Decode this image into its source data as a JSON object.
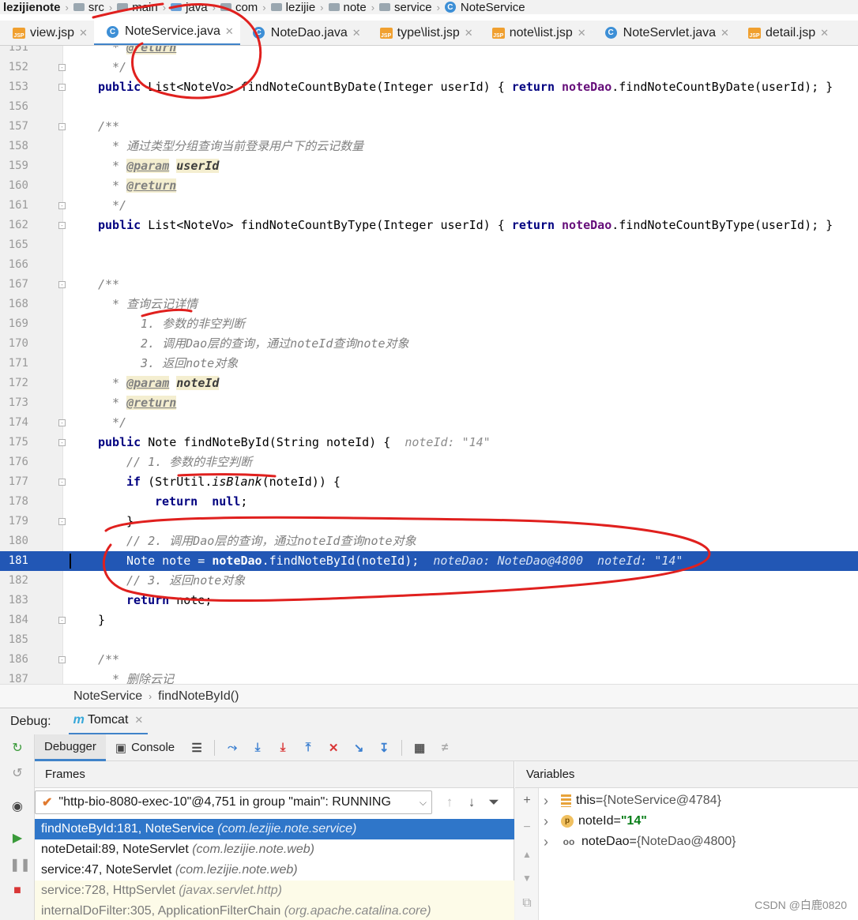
{
  "breadcrumb": [
    "lezijienote",
    "src",
    "main",
    "java",
    "com",
    "lezijie",
    "note",
    "service",
    "NoteService"
  ],
  "tabs": [
    {
      "label": "view.jsp",
      "icon": "jsp-file-icon",
      "active": false
    },
    {
      "label": "NoteService.java",
      "icon": "java-class-icon",
      "active": true
    },
    {
      "label": "NoteDao.java",
      "icon": "java-class-icon",
      "active": false
    },
    {
      "label": "type\\list.jsp",
      "icon": "jsp-file-icon",
      "active": false
    },
    {
      "label": "note\\list.jsp",
      "icon": "jsp-file-icon",
      "active": false
    },
    {
      "label": "NoteServlet.java",
      "icon": "java-class-icon",
      "active": false
    },
    {
      "label": "detail.jsp",
      "icon": "jsp-file-icon",
      "active": false
    }
  ],
  "editor": {
    "current_line": "181",
    "lines": [
      {
        "n": "151",
        "indent": 1,
        "fold": false,
        "parts": [
          {
            "t": "* ",
            "c": "cm"
          },
          {
            "t": "@return",
            "c": "tag"
          }
        ]
      },
      {
        "n": "152",
        "indent": 1,
        "fold": true,
        "parts": [
          {
            "t": "*/",
            "c": "cm"
          }
        ]
      },
      {
        "n": "153",
        "indent": 0,
        "fold": true,
        "parts": [
          {
            "t": "public ",
            "c": "kw"
          },
          {
            "t": "List<NoteVo> findNoteCountByDate(Integer userId) { ",
            "c": ""
          },
          {
            "t": "return ",
            "c": "kw"
          },
          {
            "t": "noteDao",
            "c": "fld"
          },
          {
            "t": ".findNoteCountByDate(userId); }",
            "c": ""
          }
        ]
      },
      {
        "n": "156",
        "indent": 0,
        "fold": false,
        "parts": []
      },
      {
        "n": "157",
        "indent": 0,
        "fold": true,
        "parts": [
          {
            "t": "/**",
            "c": "cm"
          }
        ]
      },
      {
        "n": "158",
        "indent": 1,
        "fold": false,
        "parts": [
          {
            "t": "* 通过类型分组查询当前登录用户下的云记数量",
            "c": "cm"
          }
        ]
      },
      {
        "n": "159",
        "indent": 1,
        "fold": false,
        "parts": [
          {
            "t": "* ",
            "c": "cm"
          },
          {
            "t": "@param",
            "c": "tag"
          },
          {
            "t": " ",
            "c": "cm"
          },
          {
            "t": "userId",
            "c": "pv"
          }
        ]
      },
      {
        "n": "160",
        "indent": 1,
        "fold": false,
        "parts": [
          {
            "t": "* ",
            "c": "cm"
          },
          {
            "t": "@return",
            "c": "tag"
          }
        ]
      },
      {
        "n": "161",
        "indent": 1,
        "fold": true,
        "parts": [
          {
            "t": "*/",
            "c": "cm"
          }
        ]
      },
      {
        "n": "162",
        "indent": 0,
        "fold": true,
        "parts": [
          {
            "t": "public ",
            "c": "kw"
          },
          {
            "t": "List<NoteVo> findNoteCountByType(Integer userId) { ",
            "c": ""
          },
          {
            "t": "return ",
            "c": "kw"
          },
          {
            "t": "noteDao",
            "c": "fld"
          },
          {
            "t": ".findNoteCountByType(userId); }",
            "c": ""
          }
        ]
      },
      {
        "n": "165",
        "indent": 0,
        "fold": false,
        "parts": []
      },
      {
        "n": "166",
        "indent": 0,
        "fold": false,
        "parts": []
      },
      {
        "n": "167",
        "indent": 0,
        "fold": true,
        "parts": [
          {
            "t": "/**",
            "c": "cm"
          }
        ]
      },
      {
        "n": "168",
        "indent": 1,
        "fold": false,
        "parts": [
          {
            "t": "* 查询云记详情",
            "c": "cm"
          }
        ]
      },
      {
        "n": "169",
        "indent": 3,
        "fold": false,
        "parts": [
          {
            "t": "1. 参数的非空判断",
            "c": "cm"
          }
        ]
      },
      {
        "n": "170",
        "indent": 3,
        "fold": false,
        "parts": [
          {
            "t": "2. 调用Dao层的查询，通过noteId查询note对象",
            "c": "cm"
          }
        ]
      },
      {
        "n": "171",
        "indent": 3,
        "fold": false,
        "parts": [
          {
            "t": "3. 返回note对象",
            "c": "cm"
          }
        ]
      },
      {
        "n": "172",
        "indent": 1,
        "fold": false,
        "parts": [
          {
            "t": "* ",
            "c": "cm"
          },
          {
            "t": "@param",
            "c": "tag"
          },
          {
            "t": " ",
            "c": "cm"
          },
          {
            "t": "noteId",
            "c": "pv"
          }
        ]
      },
      {
        "n": "173",
        "indent": 1,
        "fold": false,
        "parts": [
          {
            "t": "* ",
            "c": "cm"
          },
          {
            "t": "@return",
            "c": "tag"
          }
        ]
      },
      {
        "n": "174",
        "indent": 1,
        "fold": true,
        "parts": [
          {
            "t": "*/",
            "c": "cm"
          }
        ]
      },
      {
        "n": "175",
        "indent": 0,
        "fold": true,
        "parts": [
          {
            "t": "public ",
            "c": "kw"
          },
          {
            "t": "Note findNoteById(String noteId) {  ",
            "c": ""
          },
          {
            "t": "noteId: \"14\"",
            "c": "hint"
          }
        ]
      },
      {
        "n": "176",
        "indent": 2,
        "fold": false,
        "parts": [
          {
            "t": "// 1. 参数的非空判断",
            "c": "cm"
          }
        ]
      },
      {
        "n": "177",
        "indent": 2,
        "fold": true,
        "parts": [
          {
            "t": "if ",
            "c": "kw"
          },
          {
            "t": "(StrUtil.",
            "c": ""
          },
          {
            "t": "isBlank",
            "c": "sm"
          },
          {
            "t": "(noteId)) {",
            "c": ""
          }
        ]
      },
      {
        "n": "178",
        "indent": 4,
        "fold": false,
        "parts": [
          {
            "t": "return ",
            "c": "kw"
          },
          {
            "t": " null",
            "c": "kw"
          },
          {
            "t": ";",
            "c": ""
          }
        ]
      },
      {
        "n": "179",
        "indent": 2,
        "fold": true,
        "parts": [
          {
            "t": "}",
            "c": ""
          }
        ]
      },
      {
        "n": "180",
        "indent": 2,
        "fold": false,
        "parts": [
          {
            "t": "// 2. 调用Dao层的查询，通过noteId查询note对象",
            "c": "cm"
          }
        ]
      },
      {
        "n": "181",
        "indent": 2,
        "fold": false,
        "highlight": true,
        "parts": [
          {
            "t": "Note note = ",
            "c": ""
          },
          {
            "t": "noteDao",
            "c": "fld"
          },
          {
            "t": ".findNoteById(noteId);  ",
            "c": ""
          },
          {
            "t": "noteDao: NoteDao@4800  noteId: \"14\"",
            "c": "hint"
          }
        ]
      },
      {
        "n": "182",
        "indent": 2,
        "fold": false,
        "parts": [
          {
            "t": "// 3. 返回note对象",
            "c": "cm"
          }
        ]
      },
      {
        "n": "183",
        "indent": 2,
        "fold": false,
        "parts": [
          {
            "t": "return ",
            "c": "kw"
          },
          {
            "t": "note;",
            "c": ""
          }
        ]
      },
      {
        "n": "184",
        "indent": 0,
        "fold": true,
        "parts": [
          {
            "t": "}",
            "c": ""
          }
        ]
      },
      {
        "n": "185",
        "indent": 0,
        "fold": false,
        "parts": []
      },
      {
        "n": "186",
        "indent": 0,
        "fold": true,
        "parts": [
          {
            "t": "/**",
            "c": "cm"
          }
        ]
      },
      {
        "n": "187",
        "indent": 1,
        "fold": false,
        "parts": [
          {
            "t": "* 删除云记",
            "c": "cm"
          }
        ]
      }
    ]
  },
  "code_crumb": {
    "class": "NoteService",
    "method": "findNoteById()"
  },
  "debug": {
    "label": "Debug:",
    "session": "Tomcat",
    "tabs": {
      "debugger": "Debugger",
      "console": "Console"
    },
    "frames_header": "Frames",
    "variables_header": "Variables",
    "thread": "\"http-bio-8080-exec-10\"@4,751 in group \"main\": RUNNING",
    "frames": [
      {
        "method": "findNoteById:181, NoteService",
        "pkg": "(com.lezijie.note.service)",
        "kind": "sel"
      },
      {
        "method": "noteDetail:89, NoteServlet",
        "pkg": "(com.lezijie.note.web)",
        "kind": "app"
      },
      {
        "method": "service:47, NoteServlet",
        "pkg": "(com.lezijie.note.web)",
        "kind": "app"
      },
      {
        "method": "service:728, HttpServlet",
        "pkg": "(javax.servlet.http)",
        "kind": "lib"
      },
      {
        "method": "internalDoFilter:305, ApplicationFilterChain",
        "pkg": "(org.apache.catalina.core)",
        "kind": "lib"
      }
    ],
    "variables": [
      {
        "icon": "this-icon",
        "name": "this",
        "value": "{NoteService@4784}",
        "vtype": "obj"
      },
      {
        "icon": "parameter-icon",
        "badge": "p",
        "name": "noteId",
        "value": "\"14\"",
        "vtype": "str"
      },
      {
        "icon": "watch-glasses-icon",
        "name": "noteDao",
        "value": "{NoteDao@4800}",
        "vtype": "obj"
      }
    ]
  },
  "watermark": "CSDN @白鹿0820",
  "annotation_color": "#e0201e",
  "highlight_color": "#2257b5"
}
